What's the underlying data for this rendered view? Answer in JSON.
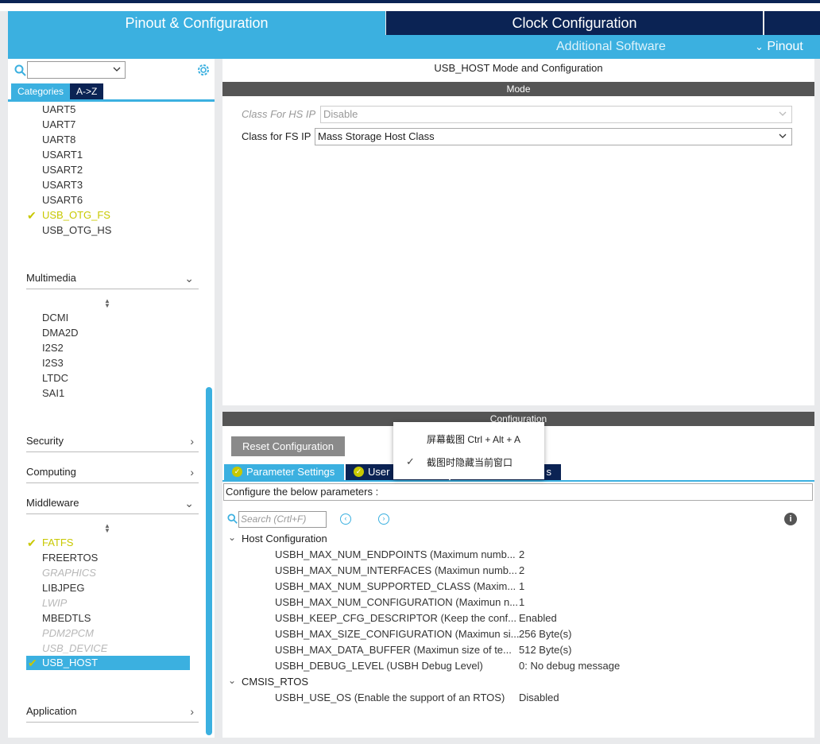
{
  "tabs": {
    "pinout_config": "Pinout & Configuration",
    "clock_config": "Clock Configuration",
    "additional_software": "Additional Software",
    "pinout": "Pinout"
  },
  "sidebar": {
    "search_value": "",
    "category_tab": "Categories",
    "az_tab": "A->Z",
    "connectivity_items": [
      "UART5",
      "UART7",
      "UART8",
      "USART1",
      "USART2",
      "USART3",
      "USART6",
      "USB_OTG_FS",
      "USB_OTG_HS"
    ],
    "multimedia": {
      "label": "Multimedia",
      "items": [
        "DCMI",
        "DMA2D",
        "I2S2",
        "I2S3",
        "LTDC",
        "SAI1"
      ]
    },
    "security": "Security",
    "computing": "Computing",
    "middleware": {
      "label": "Middleware",
      "items": [
        "FATFS",
        "FREERTOS",
        "GRAPHICS",
        "LIBJPEG",
        "LWIP",
        "MBEDTLS",
        "PDM2PCM",
        "USB_DEVICE",
        "USB_HOST"
      ]
    },
    "application": "Application"
  },
  "mode": {
    "title": "USB_HOST Mode and Configuration",
    "bar": "Mode",
    "hs_label": "Class For HS IP",
    "hs_value": "Disable",
    "fs_label": "Class for FS IP",
    "fs_value": "Mass Storage Host Class"
  },
  "config": {
    "bar": "Configuration",
    "reset": "Reset Configuration",
    "tab_params": "Parameter Settings",
    "tab_user": "User",
    "tab_partial": "s",
    "instruction": "Configure the below parameters :",
    "search_placeholder": "Search (Crtl+F)",
    "groups": {
      "host": "Host Configuration",
      "cmsis": "CMSIS_RTOS"
    },
    "params": [
      {
        "name": "USBH_MAX_NUM_ENDPOINTS (Maximum numb...",
        "value": "2"
      },
      {
        "name": "USBH_MAX_NUM_INTERFACES (Maximun numb...",
        "value": "2"
      },
      {
        "name": "USBH_MAX_NUM_SUPPORTED_CLASS (Maxim...",
        "value": "1"
      },
      {
        "name": "USBH_MAX_NUM_CONFIGURATION (Maximun n...",
        "value": "1"
      },
      {
        "name": "USBH_KEEP_CFG_DESCRIPTOR (Keep the conf...",
        "value": "Enabled"
      },
      {
        "name": "USBH_MAX_SIZE_CONFIGURATION (Maximun si...",
        "value": "256 Byte(s)"
      },
      {
        "name": "USBH_MAX_DATA_BUFFER (Maximun size of te...",
        "value": "512 Byte(s)"
      },
      {
        "name": "USBH_DEBUG_LEVEL (USBH Debug Level)",
        "value": "0: No debug message"
      }
    ],
    "rtos_param": {
      "name": "USBH_USE_OS (Enable the support of an RTOS)",
      "value": "Disabled"
    }
  },
  "context_menu": {
    "item1": "屏幕截图 Ctrl + Alt + A",
    "item2": "截图时隐藏当前窗口"
  },
  "colors": {
    "accent": "#3bb0e0",
    "navy": "#0b2354",
    "check": "#c8c800"
  }
}
